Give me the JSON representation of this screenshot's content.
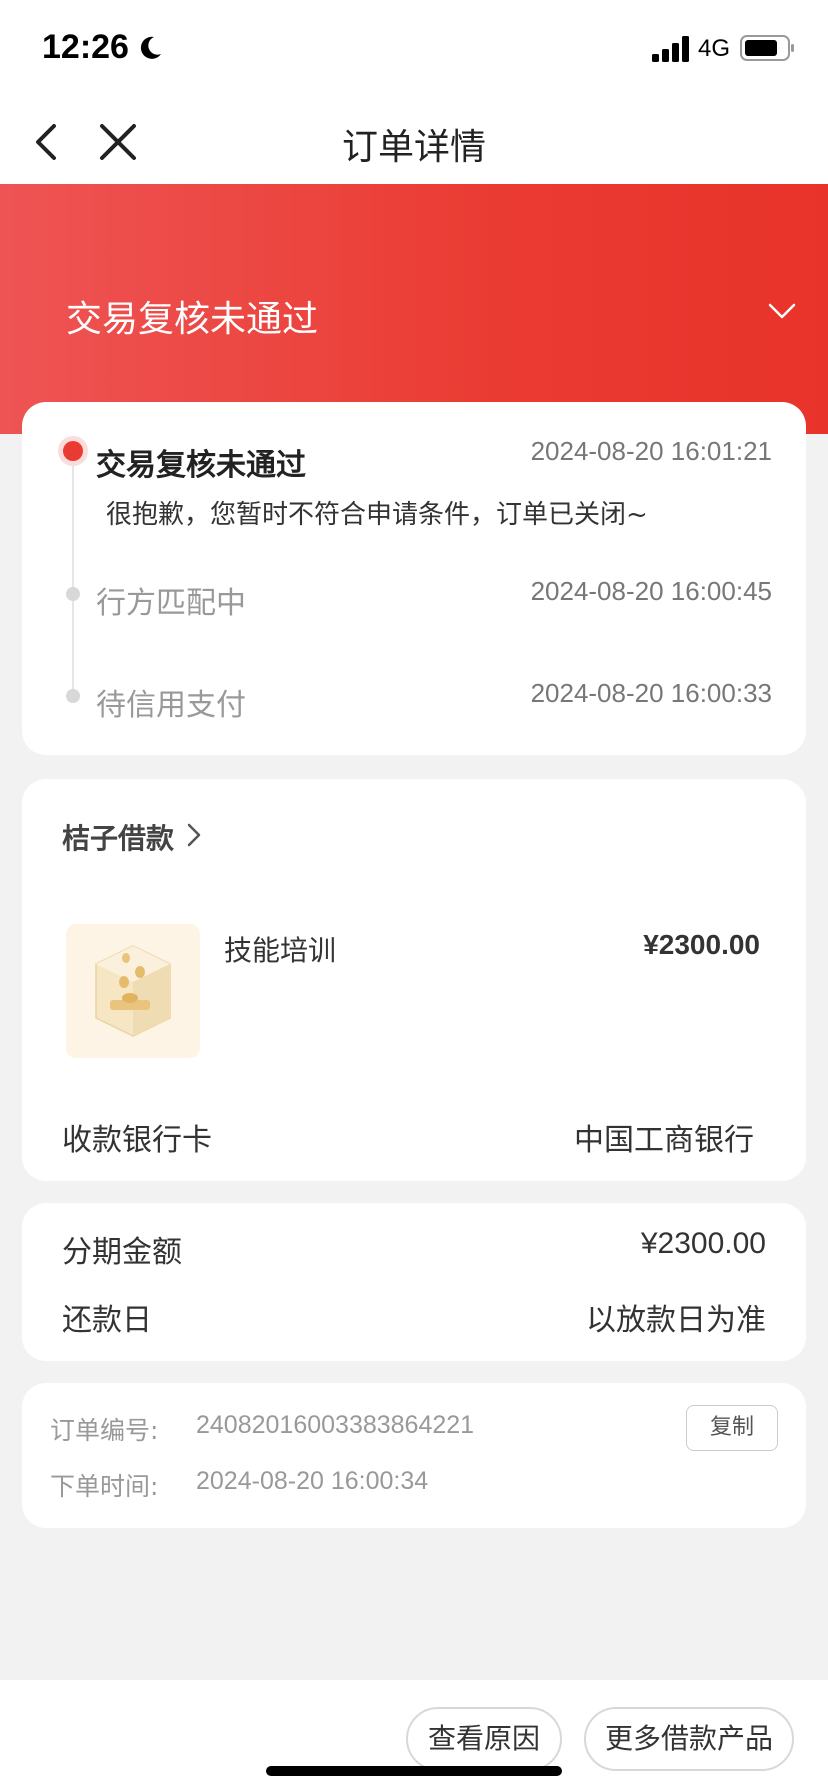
{
  "status_bar": {
    "time": "12:26",
    "network": "4G"
  },
  "nav": {
    "title": "订单详情"
  },
  "header": {
    "status": "交易复核未通过"
  },
  "timeline": {
    "steps": [
      {
        "label": "交易复核未通过",
        "time": "2024-08-20 16:01:21",
        "active": true
      },
      {
        "label": "行方匹配中",
        "time": "2024-08-20 16:00:45",
        "active": false
      },
      {
        "label": "待信用支付",
        "time": "2024-08-20 16:00:33",
        "active": false
      }
    ],
    "description": "很抱歉，您暂时不符合申请条件，订单已关闭~"
  },
  "product": {
    "provider": "桔子借款",
    "name": "技能培训",
    "price": "¥2300.00",
    "bank_label": "收款银行卡",
    "bank_value": "中国工商银行"
  },
  "installment": {
    "amount_label": "分期金额",
    "amount_value": "¥2300.00",
    "repay_label": "还款日",
    "repay_value": "以放款日为准"
  },
  "order": {
    "number_label": "订单编号:",
    "number_value": "24082016003383864221",
    "copy_label": "复制",
    "time_label": "下单时间:",
    "time_value": "2024-08-20 16:00:34"
  },
  "actions": {
    "view_reason": "查看原因",
    "more_products": "更多借款产品"
  },
  "colors": {
    "accent": "#ea3b32",
    "background": "#f2f2f2"
  }
}
